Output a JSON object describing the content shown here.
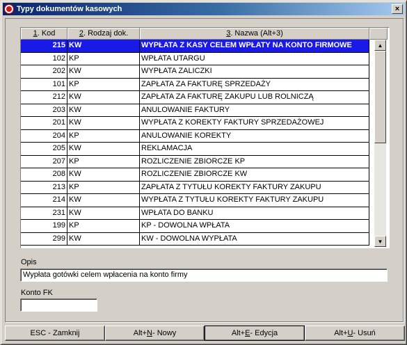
{
  "window": {
    "title": "Typy dokumentów kasowych",
    "close": "×"
  },
  "columns": [
    {
      "key": "1",
      "label": ". Kod"
    },
    {
      "key": "2",
      "label": ". Rodzaj dok."
    },
    {
      "key": "3",
      "label": ". Nazwa (Alt+3)"
    }
  ],
  "rows": [
    {
      "kod": "215",
      "rodz": "KW",
      "nazwa": "WYPŁATA Z KASY CELEM WPŁATY NA KONTO FIRMOWE",
      "selected": true
    },
    {
      "kod": "102",
      "rodz": "KP",
      "nazwa": "WPŁATA UTARGU"
    },
    {
      "kod": "202",
      "rodz": "KW",
      "nazwa": "WYPŁATA ZALICZKI"
    },
    {
      "kod": "101",
      "rodz": "KP",
      "nazwa": "ZAPŁATA ZA FAKTURĘ SPRZEDAŻY"
    },
    {
      "kod": "212",
      "rodz": "KW",
      "nazwa": "ZAPŁATA ZA FAKTURĘ ZAKUPU LUB ROLNICZĄ"
    },
    {
      "kod": "203",
      "rodz": "KW",
      "nazwa": "ANULOWANIE FAKTURY"
    },
    {
      "kod": "201",
      "rodz": "KW",
      "nazwa": "WYPŁATA Z KOREKTY FAKTURY SPRZEDAŻOWEJ"
    },
    {
      "kod": "204",
      "rodz": "KP",
      "nazwa": "ANULOWANIE KOREKTY"
    },
    {
      "kod": "205",
      "rodz": "KW",
      "nazwa": "REKLAMACJA"
    },
    {
      "kod": "207",
      "rodz": "KP",
      "nazwa": "ROZLICZENIE ZBIORCZE KP"
    },
    {
      "kod": "208",
      "rodz": "KW",
      "nazwa": "ROZLICZENIE ZBIORCZE KW"
    },
    {
      "kod": "213",
      "rodz": "KP",
      "nazwa": "ZAPŁATA Z TYTUŁU KOREKTY FAKTURY ZAKUPU"
    },
    {
      "kod": "214",
      "rodz": "KW",
      "nazwa": "WYPŁATA Z TYTUŁU KOREKTY FAKTURY ZAKUPU"
    },
    {
      "kod": "231",
      "rodz": "KW",
      "nazwa": "WPŁATA DO BANKU"
    },
    {
      "kod": "199",
      "rodz": "KP",
      "nazwa": "KP - DOWOLNA WPŁATA"
    },
    {
      "kod": "299",
      "rodz": "KW",
      "nazwa": "KW - DOWOLNA WYPŁATA"
    }
  ],
  "opis": {
    "label": "Opis",
    "value": "Wypłata gotówki celem wpłacenia na konto firmy"
  },
  "konto": {
    "label": "Konto FK",
    "value": ""
  },
  "buttons": [
    {
      "name": "esc-close-button",
      "label": "ESC - Zamknij"
    },
    {
      "name": "new-button",
      "pre": "Alt+",
      "key": "N",
      "post": " - Nowy"
    },
    {
      "name": "edit-button",
      "pre": "Alt+",
      "key": "E",
      "post": " - Edycja",
      "focused": true
    },
    {
      "name": "delete-button",
      "pre": "Alt+",
      "key": "U",
      "post": " - Usuń"
    }
  ],
  "colors": {
    "selection": "#1a1ae8",
    "titlebar": "#0a246a",
    "face": "#d4d0c8"
  },
  "scrollbar": {
    "up": "▲",
    "down": "▼"
  }
}
